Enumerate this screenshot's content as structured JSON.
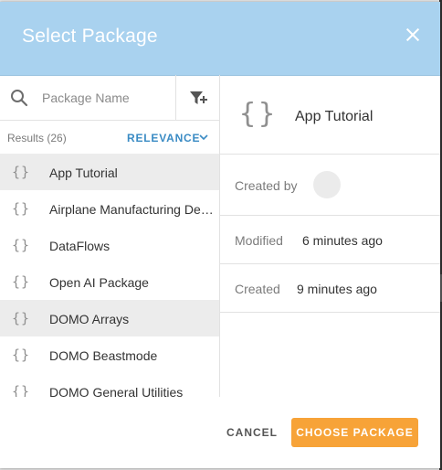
{
  "dialog": {
    "title": "Select Package",
    "close_icon": "close-icon"
  },
  "search": {
    "placeholder": "Package Name",
    "search_icon": "search-icon",
    "filter_icon": "filter-add-icon"
  },
  "results": {
    "count_label": "Results (26)",
    "sort_label": "RELEVANCE",
    "sort_icon": "chevron-down-icon"
  },
  "packages": [
    {
      "icon": "braces-icon",
      "label": "App Tutorial",
      "selected": true
    },
    {
      "icon": "braces-icon",
      "label": "Airplane Manufacturing Demo",
      "selected": false
    },
    {
      "icon": "braces-icon",
      "label": "DataFlows",
      "selected": false
    },
    {
      "icon": "braces-icon",
      "label": "Open AI Package",
      "selected": false
    },
    {
      "icon": "braces-icon",
      "label": "DOMO Arrays",
      "selected": false
    },
    {
      "icon": "braces-icon",
      "label": "DOMO Beastmode",
      "selected": false
    },
    {
      "icon": "braces-icon",
      "label": "DOMO General Utilities",
      "selected": false
    }
  ],
  "detail": {
    "icon": "braces-icon",
    "name": "App Tutorial",
    "created_by_label": "Created by",
    "modified_label": "Modified",
    "modified_value": "6 minutes ago",
    "created_label": "Created",
    "created_value": "9 minutes ago"
  },
  "footer": {
    "cancel_label": "CANCEL",
    "choose_label": "CHOOSE PACKAGE"
  },
  "colors": {
    "header": "#a9d2ef",
    "accent_button": "#f7a338",
    "link": "#3a8bc4",
    "selected_row": "#ececec"
  }
}
